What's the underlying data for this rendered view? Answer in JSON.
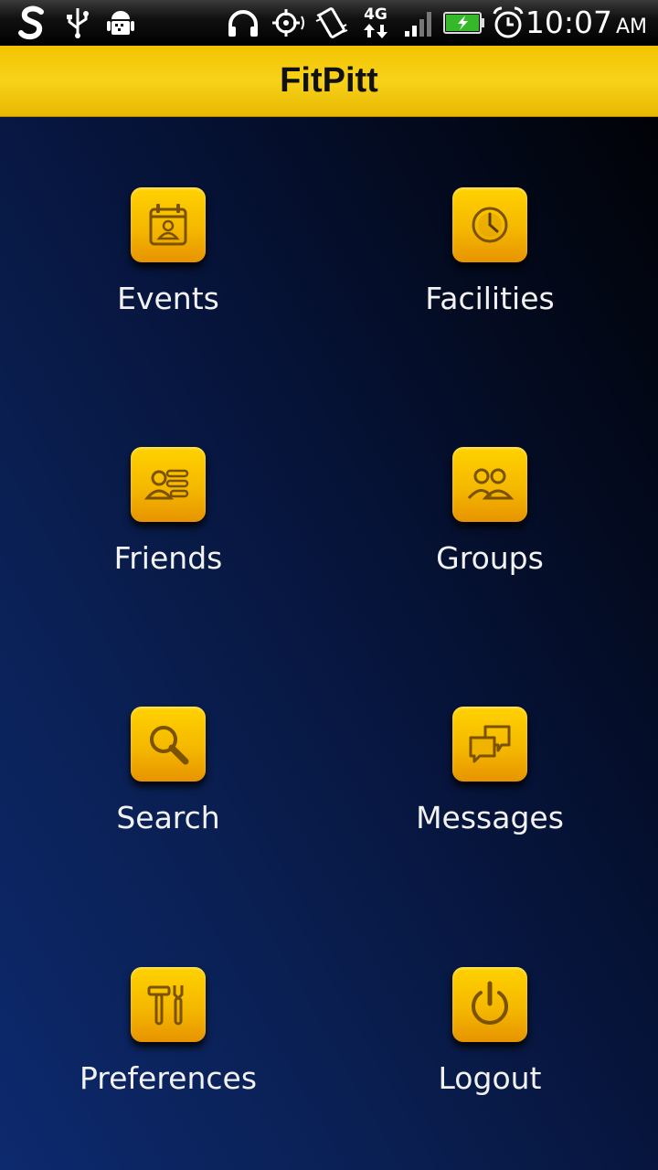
{
  "status_bar": {
    "time": "10:07",
    "ampm": "AM",
    "network": "4G",
    "icons": [
      "app-s-icon",
      "usb-icon",
      "android-debug-icon",
      "headphones-icon",
      "gps-icon",
      "vibrate-icon",
      "network-4g-icon",
      "signal-icon",
      "battery-charging-icon",
      "alarm-icon"
    ],
    "battery_color": "#35b82a"
  },
  "app": {
    "title": "FitPitt",
    "accent": "#f5c000"
  },
  "menu": [
    {
      "label": "Events",
      "icon": "calendar-person-icon"
    },
    {
      "label": "Facilities",
      "icon": "clock-icon"
    },
    {
      "label": "Friends",
      "icon": "friends-list-icon"
    },
    {
      "label": "Groups",
      "icon": "groups-icon"
    },
    {
      "label": "Search",
      "icon": "magnifier-icon"
    },
    {
      "label": "Messages",
      "icon": "chat-bubbles-icon"
    },
    {
      "label": "Preferences",
      "icon": "tools-icon"
    },
    {
      "label": "Logout",
      "icon": "power-icon"
    }
  ]
}
